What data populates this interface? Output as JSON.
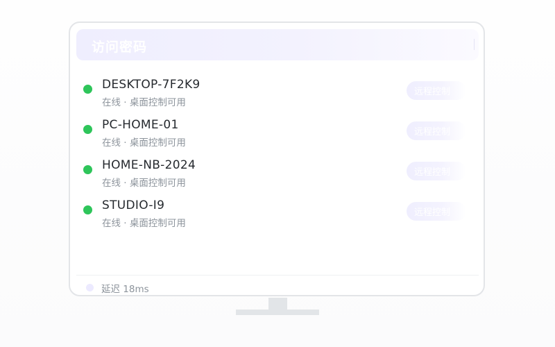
{
  "banner": {
    "title": "访问密码"
  },
  "devices": [
    {
      "name": "DESKTOP-7F2K9",
      "status": "在线 · 桌面控制可用",
      "action": "远程控制"
    },
    {
      "name": "PC-HOME-01",
      "status": "在线 · 桌面控制可用",
      "action": "远程控制"
    },
    {
      "name": "HOME-NB-2024",
      "status": "在线 · 桌面控制可用",
      "action": "远程控制"
    },
    {
      "name": "STUDIO-I9",
      "status": "在线 · 桌面控制可用",
      "action": "远程控制"
    }
  ],
  "footer": {
    "latency": "延迟 18ms"
  },
  "colors": {
    "online": "#2ec55a",
    "accent": "#efeefe",
    "text_primary": "#25292e",
    "text_secondary": "#8d949c"
  }
}
